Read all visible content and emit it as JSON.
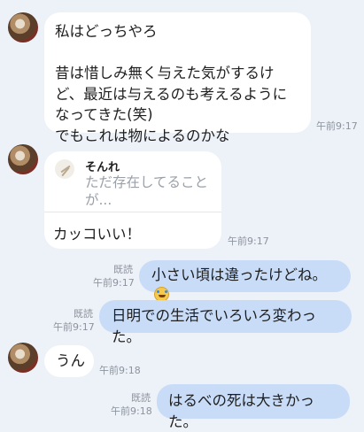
{
  "messages": [
    {
      "id": "m1",
      "sender": "other",
      "text": "私はどっちやろ\n\n昔は惜しみ無く与えた気がするけど、最近は与えるのも考えるようになってきた(笑)\nでもこれは物によるのかな",
      "time": "午前9:17"
    },
    {
      "id": "m2",
      "sender": "other",
      "quote_name": "そんれ",
      "quote_text": "ただ存在してることが...",
      "text": "カッコいい！",
      "time": "午前9:17"
    },
    {
      "id": "m3",
      "sender": "me",
      "read": "既読",
      "text": "小さい頃は違ったけどね。",
      "emoji": "rolling-on-floor-laughing-icon",
      "time": "午前9:17"
    },
    {
      "id": "m4",
      "sender": "me",
      "read": "既読",
      "text": "日明での生活でいろいろ変わった。",
      "time": "午前9:17"
    },
    {
      "id": "m5",
      "sender": "other",
      "text": "うん",
      "time": "午前9:18"
    },
    {
      "id": "m6",
      "sender": "me",
      "read": "既読",
      "text": "はるべの死は大きかった。",
      "time": "午前9:18"
    }
  ],
  "colors": {
    "background": "#edf1f8",
    "incoming_bubble": "#ffffff",
    "outgoing_bubble": "#c8dcf8",
    "meta_text": "#8d949d"
  }
}
